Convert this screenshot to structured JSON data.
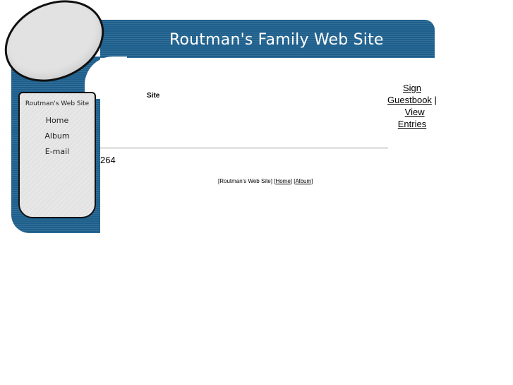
{
  "header": {
    "site_title": "Routman's Family Web Site"
  },
  "sidebar": {
    "title": "Routman's Web Site",
    "items": [
      {
        "label": "Home"
      },
      {
        "label": "Album"
      },
      {
        "label": "E-mail"
      }
    ]
  },
  "main": {
    "heading": "Site",
    "hit_counter": "264"
  },
  "guestbook": {
    "sign_label": "Sign Guestbook",
    "separator": "|",
    "view_label": "View Entries"
  },
  "footer": {
    "site_label": "Routman's Web Site",
    "home_label": "Home",
    "album_label": "Album"
  },
  "colors": {
    "brand_blue": "#1d5f8c",
    "panel_gray": "#e3e3e3"
  }
}
